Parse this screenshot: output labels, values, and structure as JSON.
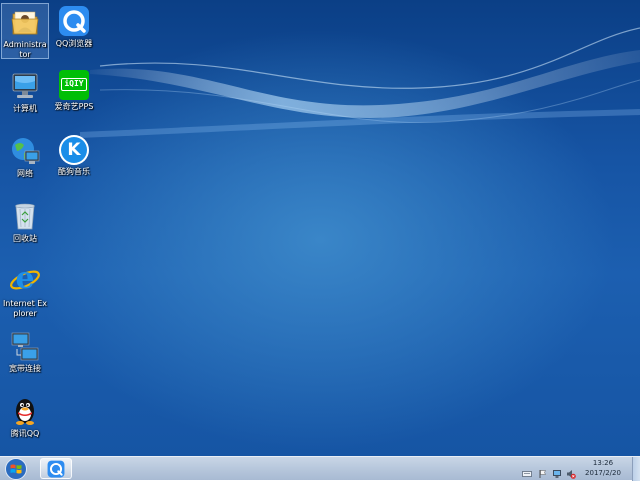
{
  "desktop": {
    "icons": [
      {
        "name": "administrator-folder",
        "label": "Administrator"
      },
      {
        "name": "qq-browser",
        "label": "QQ浏览器"
      },
      {
        "name": "computer",
        "label": "计算机"
      },
      {
        "name": "iqiyi-pps",
        "label": "爱奇艺PPS"
      },
      {
        "name": "network",
        "label": "网络"
      },
      {
        "name": "kugou-music",
        "label": "酷狗音乐"
      },
      {
        "name": "recycle-bin",
        "label": "回收站"
      },
      {
        "name": "internet-explorer",
        "label": "Internet Explorer"
      },
      {
        "name": "broadband-connection",
        "label": "宽带连接"
      },
      {
        "name": "tencent-qq",
        "label": "腾讯QQ"
      }
    ],
    "iqiyi_logo_text": "iQIY",
    "kugou_logo_text": "K",
    "ie_logo_text": "e"
  },
  "taskbar": {
    "pinned": [
      {
        "name": "qq-browser"
      }
    ],
    "clock": {
      "time": "13:26",
      "date": "2017/2/20"
    }
  },
  "colors": {
    "iqiyi_green": "#00be06",
    "kugou_blue": "#1a8de8",
    "qq_browser_blue": "#2d8cf0",
    "taskbar_bg": "#b7c7dc"
  }
}
